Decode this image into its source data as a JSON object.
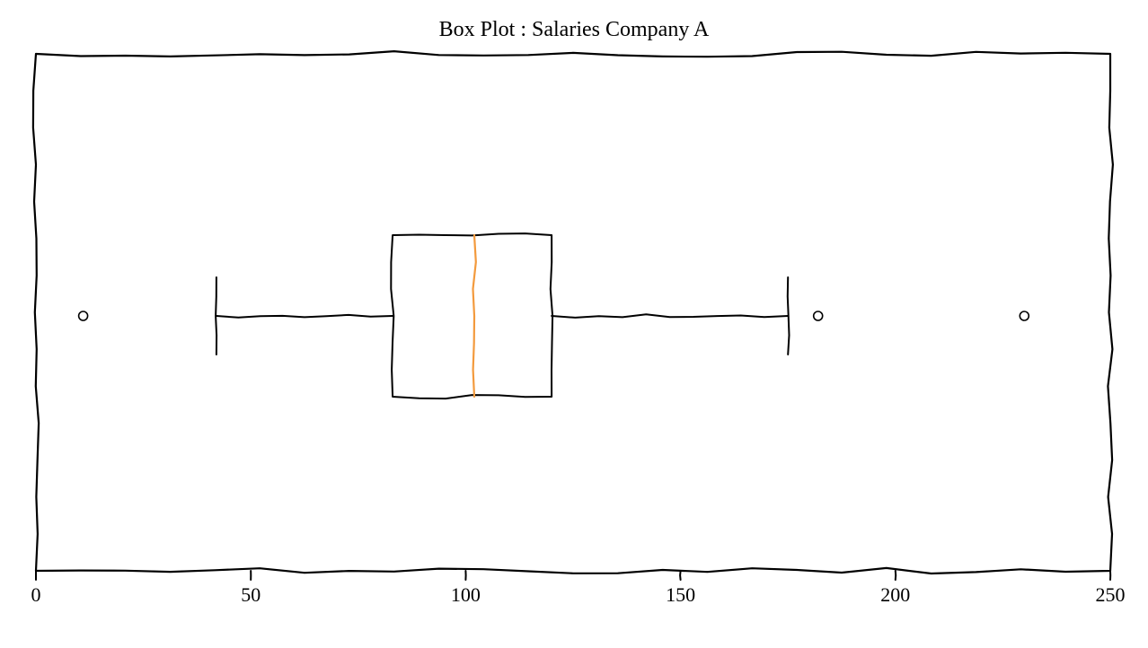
{
  "chart_data": {
    "type": "boxplot",
    "title": "Box Plot : Salaries Company A",
    "x_axis": {
      "min": 0,
      "max": 250,
      "ticks": [
        0,
        50,
        100,
        150,
        200,
        250
      ]
    },
    "box": {
      "whisker_low": 42,
      "q1": 83,
      "median": 102,
      "q3": 120,
      "whisker_high": 175
    },
    "outliers": [
      11,
      182,
      230
    ],
    "colors": {
      "box_stroke": "#000000",
      "median_stroke": "#f39a3d",
      "outlier_stroke": "#000000"
    }
  }
}
